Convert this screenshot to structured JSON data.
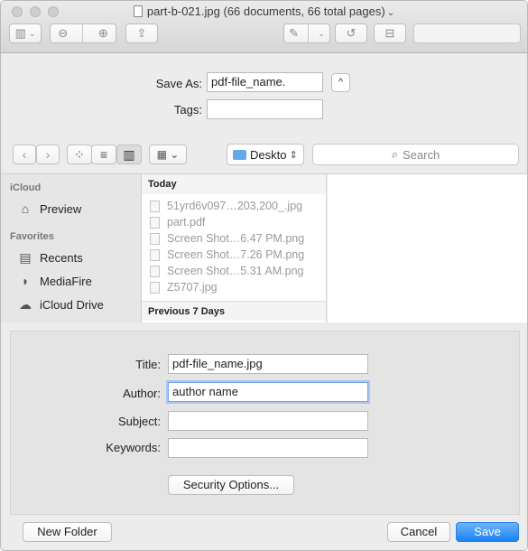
{
  "window": {
    "title": "part-b-021.jpg (66 documents, 66 total pages)",
    "title_chevron": "⌄"
  },
  "toolbar": {
    "sidebar_glyph": "▥",
    "zoom_out_glyph": "⊖",
    "zoom_in_glyph": "⊕",
    "share_glyph": "⇪",
    "markup_glyph": "✎",
    "rotate_glyph": "↺",
    "toolbox_glyph": "⊟",
    "dropdown_glyph": "⌄"
  },
  "save": {
    "save_as_label": "Save As:",
    "save_as_value": "pdf-file_name.",
    "tags_label": "Tags:",
    "tags_value": "",
    "expand_glyph": "^"
  },
  "nav": {
    "back_glyph": "‹",
    "forward_glyph": "›",
    "view_icon_glyph": "⁘",
    "view_list_glyph": "≡",
    "view_column_glyph": "▥",
    "view_gallery_glyph": "▦ ⌄",
    "location": "Deskto",
    "location_chevron": "⇕",
    "search_placeholder": "Search",
    "search_glyph": "⌕"
  },
  "sidebar": {
    "sections": [
      {
        "heading": "iCloud",
        "items": [
          {
            "label": "Preview",
            "icon": "preview-icon",
            "glyph": "⌂"
          }
        ]
      },
      {
        "heading": "Favorites",
        "items": [
          {
            "label": "Recents",
            "icon": "recents-icon",
            "glyph": "▤"
          },
          {
            "label": "MediaFire",
            "icon": "mediafire-icon",
            "glyph": "◗"
          },
          {
            "label": "iCloud Drive",
            "icon": "cloud-icon",
            "glyph": "☁"
          }
        ]
      }
    ]
  },
  "files": {
    "today_heading": "Today",
    "today": [
      "51yrd6v097…203,200_.jpg",
      "part.pdf",
      "Screen Shot…6.47 PM.png",
      "Screen Shot…7.26 PM.png",
      "Screen Shot…5.31 AM.png",
      "Z5707.jpg"
    ],
    "previous_heading": "Previous 7 Days"
  },
  "pdf_options": {
    "title_label": "Title:",
    "title_value": "pdf-file_name.jpg",
    "author_label": "Author:",
    "author_value": "author name",
    "subject_label": "Subject:",
    "subject_value": "",
    "keywords_label": "Keywords:",
    "keywords_value": "",
    "security_button": "Security Options..."
  },
  "footer": {
    "new_folder": "New Folder",
    "cancel": "Cancel",
    "save": "Save"
  },
  "colors": {
    "accent": "#1b82f3",
    "focus_ring": "#a9c7ef",
    "folder": "#63a8e8"
  }
}
